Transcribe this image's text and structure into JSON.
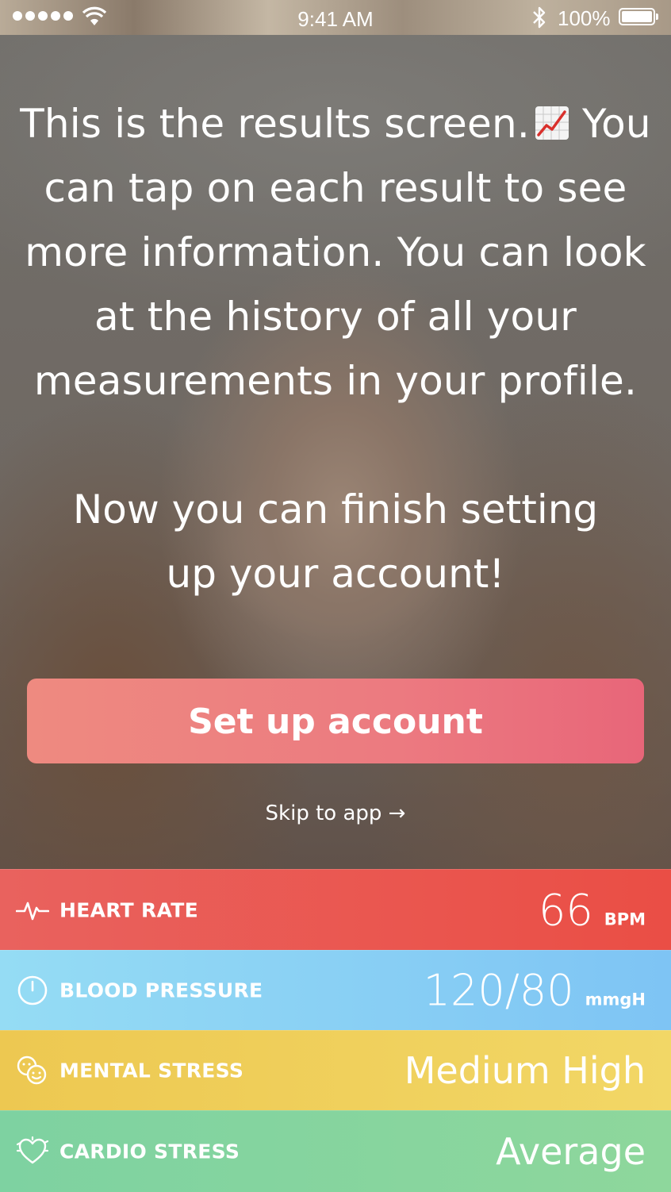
{
  "status_bar": {
    "time": "9:41 AM",
    "battery": "100%"
  },
  "intro": {
    "text": "This is the results screen.",
    "emoji_icon": "chart-increasing-icon",
    "text_2": "You can tap on each result to see more information. You can look at the history of all your measurements in your profile."
  },
  "finish": {
    "line1": "Now you can finish setting",
    "line2": "up your account!"
  },
  "setup_button": {
    "label": "Set up account",
    "color_start": "#ee8a80",
    "color_end": "#e86679"
  },
  "skip_link": {
    "label": "Skip to app →"
  },
  "results": [
    {
      "label": "HEART RATE",
      "value": "66",
      "unit": "BPM",
      "icon": "heartbeat-icon",
      "color": "#ea5852"
    },
    {
      "label": "BLOOD PRESSURE",
      "value": "120/80",
      "unit": "mmgH",
      "icon": "gauge-icon",
      "color": "#89d0f4"
    },
    {
      "label": "MENTAL STRESS",
      "value": "Medium High",
      "icon": "faces-icon",
      "color": "#f0cf5c"
    },
    {
      "label": "CARDIO STRESS",
      "value": "Average",
      "icon": "heart-stress-icon",
      "color": "#86d49e"
    }
  ]
}
